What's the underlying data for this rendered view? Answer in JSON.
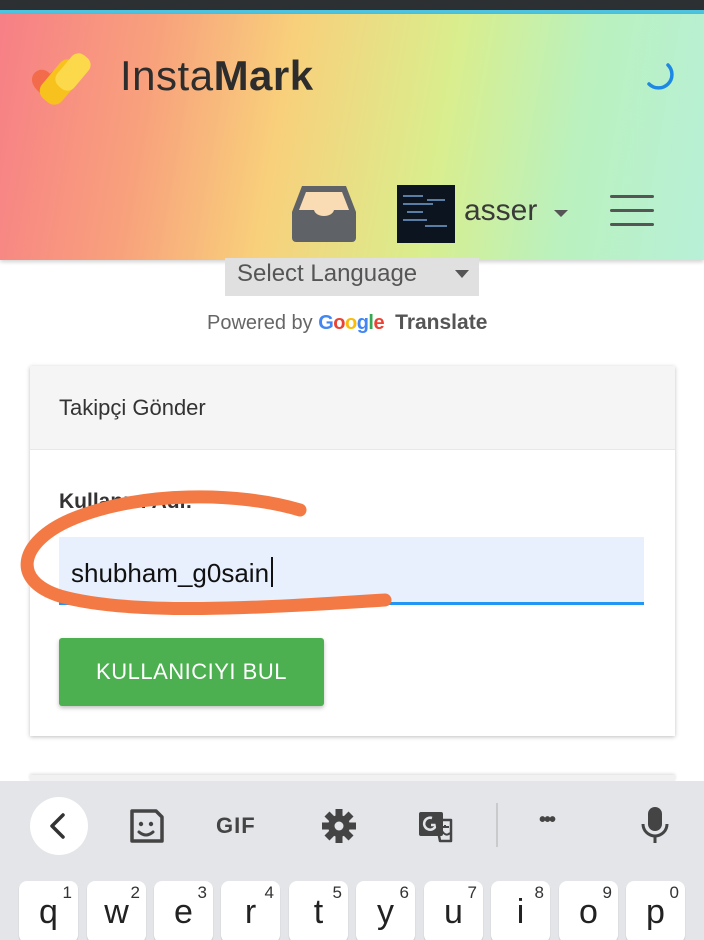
{
  "header": {
    "brand_light": "Insta",
    "brand_bold": "Mark",
    "username": "asser",
    "colors": {
      "gradient_start": "#f77f86",
      "gradient_mid": "#f8d07b",
      "gradient_end": "#b8f0d8",
      "logo_heart": "#f26b4a",
      "logo_tag": "#f8c21e",
      "spinner": "#1e88e5"
    }
  },
  "translate": {
    "select_label": "Select Language",
    "powered_by": "Powered by",
    "google": [
      "G",
      "o",
      "o",
      "g",
      "l",
      "e"
    ],
    "google_colors": [
      "#4285f4",
      "#ea4335",
      "#fbbc05",
      "#4285f4",
      "#34a853",
      "#ea4335"
    ],
    "translate_word": "Translate"
  },
  "card": {
    "title": "Takipçi Gönder",
    "field_label": "Kullanıcı Adı:",
    "field_value": "shubham_g0sain",
    "button_label": "KULLANICIYI BUL",
    "colors": {
      "button": "#4caf50",
      "field_bg": "#e8f0fe",
      "field_underline": "#2196f3"
    }
  },
  "annotation": {
    "color": "#f47a45"
  },
  "keyboard": {
    "toolbar": {
      "gif_label": "GIF",
      "more_label": "•••",
      "icons": [
        "back-chevron-icon",
        "sticker-icon",
        "gif-icon",
        "settings-gear-icon",
        "translate-icon",
        "more-icon",
        "microphone-icon"
      ]
    },
    "row1": [
      {
        "ch": "q",
        "num": "1"
      },
      {
        "ch": "w",
        "num": "2"
      },
      {
        "ch": "e",
        "num": "3"
      },
      {
        "ch": "r",
        "num": "4"
      },
      {
        "ch": "t",
        "num": "5"
      },
      {
        "ch": "y",
        "num": "6"
      },
      {
        "ch": "u",
        "num": "7"
      },
      {
        "ch": "i",
        "num": "8"
      },
      {
        "ch": "o",
        "num": "9"
      },
      {
        "ch": "p",
        "num": "0"
      }
    ]
  }
}
